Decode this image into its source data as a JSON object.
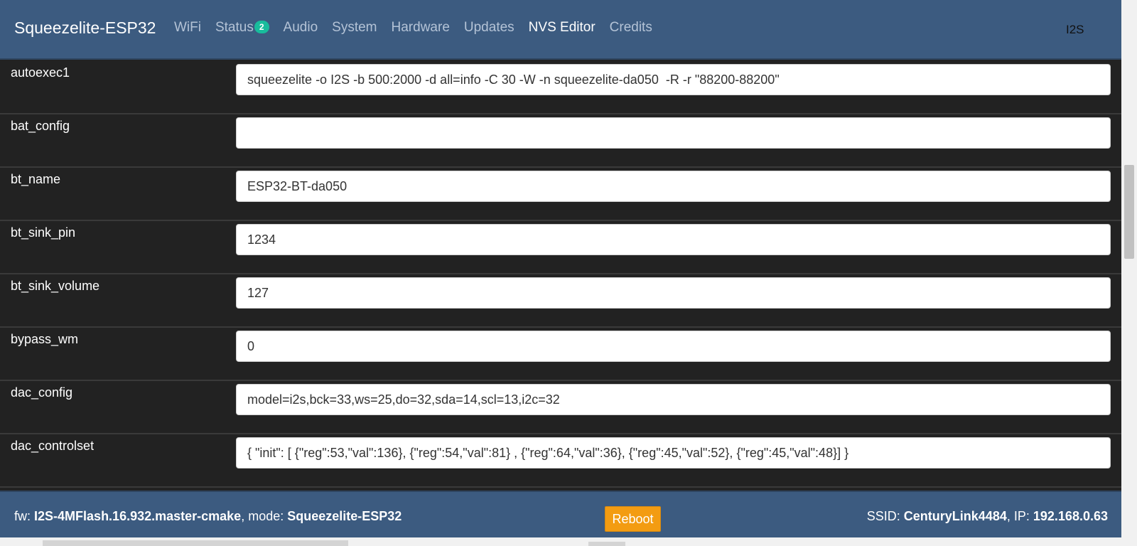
{
  "app": {
    "brand": "Squeezelite-ESP32",
    "nav": [
      {
        "label": "WiFi"
      },
      {
        "label": "Status",
        "badge": "2"
      },
      {
        "label": "Audio"
      },
      {
        "label": "System"
      },
      {
        "label": "Hardware"
      },
      {
        "label": "Updates"
      },
      {
        "label": "NVS Editor",
        "active": true
      },
      {
        "label": "Credits"
      }
    ],
    "nav_right": "I2S"
  },
  "nvs": {
    "rows": [
      {
        "key": "autoexec1",
        "value": "squeezelite -o I2S -b 500:2000 -d all=info -C 30 -W -n squeezelite-da050  -R -r \"88200-88200\""
      },
      {
        "key": "bat_config",
        "value": ""
      },
      {
        "key": "bt_name",
        "value": "ESP32-BT-da050"
      },
      {
        "key": "bt_sink_pin",
        "value": "1234"
      },
      {
        "key": "bt_sink_volume",
        "value": "127"
      },
      {
        "key": "bypass_wm",
        "value": "0"
      },
      {
        "key": "dac_config",
        "value": "model=i2s,bck=33,ws=25,do=32,sda=14,scl=13,i2c=32"
      },
      {
        "key": "dac_controlset",
        "value": "{ \"init\": [ {\"reg\":53,\"val\":136}, {\"reg\":54,\"val\":81} , {\"reg\":64,\"val\":36}, {\"reg\":45,\"val\":52}, {\"reg\":45,\"val\":48}] }"
      }
    ]
  },
  "footer": {
    "fw_label": "fw:",
    "fw_value": "I2S-4MFlash.16.932.master-cmake",
    "mode_label": ", mode:",
    "mode_value": "Squeezelite-ESP32",
    "reboot_label": "Reboot",
    "ssid_label": "SSID:",
    "ssid_value": "CenturyLink4484",
    "ip_label": ", IP:",
    "ip_value": "192.168.0.63"
  },
  "colors": {
    "navbar": "#3c5b80",
    "background": "#222222",
    "badge": "#18bc9c",
    "reboot": "#f39c12"
  }
}
